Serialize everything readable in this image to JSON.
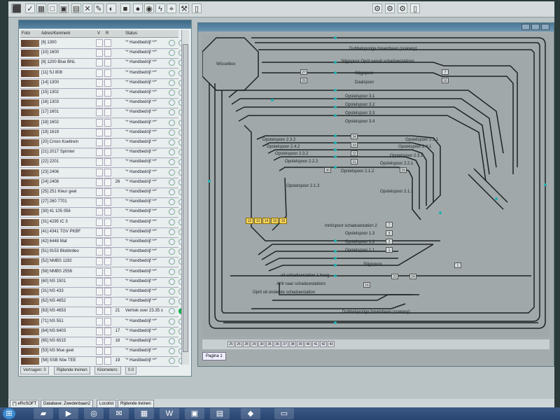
{
  "track_window": {
    "labels": {
      "top1": "Dubbelsporige bovenbaan (scenery)",
      "top2": "Stijgspoor   Oprit vanuit schaduwstations",
      "stijg": "Stijgspoor",
      "daal": "Daalspoor",
      "o31": "Opstelspoor 3.1",
      "o32": "Opstelspoor 3.2",
      "o33": "Opstelspoor 3.3",
      "o34": "Opstelspoor 3.4",
      "o232": "Opstelspoor 2.3.2",
      "o242": "Opstelspoor 2.4.2",
      "o2321": "Opstelspoor 2.3.2",
      "o222": "Opstelspoor 2.2.2",
      "o212": "Opstelspoor 2.1.2",
      "o213": "Opstelspoor 2.1.3",
      "o231r": "Opstelspoor 2.3.1",
      "o241": "Opstelspoor 2.4.1",
      "o2311": "Opstelspoor 2.3.1",
      "o221": "Opstelspoor 2.2.1",
      "o211": "Opstelspoor 2.1.1",
      "inrit": "Inrit/spoor schaduwstation 2",
      "o13": "Opstelspoor 1.3",
      "o12": "Opstelspoor 1.2",
      "o11": "Opstelspoor 1.1",
      "stijg2": "Stijgspoor",
      "uit1": "uit schaduwstation 1 hoog",
      "afrit": "Afrit naar schaduwstations",
      "oprit": "Oprit uit onderste schaduwstation",
      "bottom": "Dubbelsporige bovenbaan (scenery)",
      "wisselbox": "Wisselbox"
    },
    "numbers": {
      "n26": "26",
      "n34": "34",
      "n33": "33",
      "n32": "32",
      "n31": "31",
      "n30": "30",
      "n29": "29",
      "n7": "7",
      "n3": "3",
      "n2": "2",
      "n1": "1",
      "n23": "23",
      "n24": "24",
      "n16": "16",
      "n27": "27"
    },
    "yellow_boxes": [
      "12",
      "13",
      "14",
      "15",
      "16"
    ],
    "page_numbers": [
      "25",
      "26",
      "28",
      "29",
      "30",
      "35",
      "36",
      "37",
      "38",
      "39",
      "40",
      "41",
      "42",
      "43"
    ],
    "page_tab": "Pagina 1"
  },
  "loco_list": {
    "columns": [
      "Foto",
      "Adres/Kenmerk",
      "V",
      "R",
      "Status"
    ],
    "rows": [
      {
        "name": "[6] 1300",
        "speed": "",
        "status": "\"* Handbedrijf **\"",
        "on": false
      },
      {
        "name": "[10] 1600",
        "speed": "",
        "status": "\"* Handbedrijf **\"",
        "on": false
      },
      {
        "name": "[8] 1200 Blue BNL",
        "speed": "",
        "status": "\"* Handbedrijf **\"",
        "on": false
      },
      {
        "name": "[11] SJ 808",
        "speed": "",
        "status": "\"* Handbedrijf **\"",
        "on": false
      },
      {
        "name": "[14] 1300",
        "speed": "",
        "status": "\"* Handbedrijf **\"",
        "on": false
      },
      {
        "name": "[15] 1302",
        "speed": "",
        "status": "\"* Handbedrijf **\"",
        "on": false
      },
      {
        "name": "[16] 1303",
        "speed": "",
        "status": "\"* Handbedrijf **\"",
        "on": false
      },
      {
        "name": "[17] 1601",
        "speed": "",
        "status": "\"* Handbedrijf **\"",
        "on": false
      },
      {
        "name": "[18] 1602",
        "speed": "",
        "status": "\"* Handbedrijf **\"",
        "on": false
      },
      {
        "name": "[19] 1619",
        "speed": "",
        "status": "\"* Handbedrijf **\"",
        "on": false
      },
      {
        "name": "[20] Cmon Koeltrein",
        "speed": "",
        "status": "\"* Handbedrijf **\"",
        "on": false
      },
      {
        "name": "[21] 2017 Sprinter",
        "speed": "",
        "status": "\"* Handbedrijf **\"",
        "on": false
      },
      {
        "name": "[22] 2201",
        "speed": "",
        "status": "\"* Handbedrijf **\"",
        "on": false
      },
      {
        "name": "[23] 2406",
        "speed": "",
        "status": "\"* Handbedrijf **\"",
        "on": false
      },
      {
        "name": "[24] 2408",
        "speed": "26",
        "status": "\"* Handbedrijf **\"",
        "on": false
      },
      {
        "name": "[25] 251 Kleur geel",
        "speed": "",
        "status": "\"* Handbedrijf **\"",
        "on": false
      },
      {
        "name": "[27] 260 7701",
        "speed": "",
        "status": "\"* Handbedrijf **\"",
        "on": false
      },
      {
        "name": "[30] 41 105 056",
        "speed": "",
        "status": "\"* Handbedrijf **\"",
        "on": false
      },
      {
        "name": "[31] 4295 IC 3",
        "speed": "",
        "status": "\"* Handbedrijf **\"",
        "on": false
      },
      {
        "name": "[41] 4341 TGV PKBF",
        "speed": "",
        "status": "\"* Handbedrijf **\"",
        "on": false
      },
      {
        "name": "[42] 6448 Mat",
        "speed": "",
        "status": "\"* Handbedrijf **\"",
        "on": false
      },
      {
        "name": "[51] 9153 Blokbrdeo",
        "speed": "",
        "status": "\"* Handbedrijf **\"",
        "on": false
      },
      {
        "name": "[52] NMBS 1192",
        "speed": "",
        "status": "\"* Handbedrijf **\"",
        "on": false
      },
      {
        "name": "[58] NMBS 2556",
        "speed": "",
        "status": "\"* Handbedrijf **\"",
        "on": false
      },
      {
        "name": "[60] NS 1501",
        "speed": "",
        "status": "\"* Handbedrijf **\"",
        "on": false
      },
      {
        "name": "[31] NS 433",
        "speed": "",
        "status": "\"* Handbedrijf **\"",
        "on": false
      },
      {
        "name": "[62] NS 4652",
        "speed": "",
        "status": "\"* Handbedrijf **\"",
        "on": false
      },
      {
        "name": "[63] NS 4653",
        "speed": "21",
        "status": "Vertrek over 23.35 s",
        "on": true
      },
      {
        "name": "[71] NS 551",
        "speed": "",
        "status": "\"* Handbedrijf **\"",
        "on": false
      },
      {
        "name": "[64] NS 6403",
        "speed": "17",
        "status": "\"* Handbedrijf **\"",
        "on": false
      },
      {
        "name": "[65] NS 6515",
        "speed": "16",
        "status": "\"* Handbedrijf **\"",
        "on": false
      },
      {
        "name": "[53] NS Mue geel",
        "speed": "",
        "status": "\"* Handbedrijf **\"",
        "on": false
      },
      {
        "name": "[58] SSB Nöe TEE",
        "speed": "19",
        "status": "\"* Handbedrijf **\"",
        "on": false
      }
    ],
    "bottom": {
      "left": "Vertragen: 0",
      "mid": "Rijdende treinen",
      "right": "Kilometers:",
      "km": "0.0"
    }
  },
  "window_tabs": [
    "[*] eRoSOFT",
    "Database: Zwedenbaan2",
    "Locolist",
    "Rijdende treinen"
  ],
  "colors": {
    "track": "#1d2325",
    "sensor": "#20b0b0",
    "led_on": "#20b040",
    "label_yellow": "#f6d45a"
  }
}
